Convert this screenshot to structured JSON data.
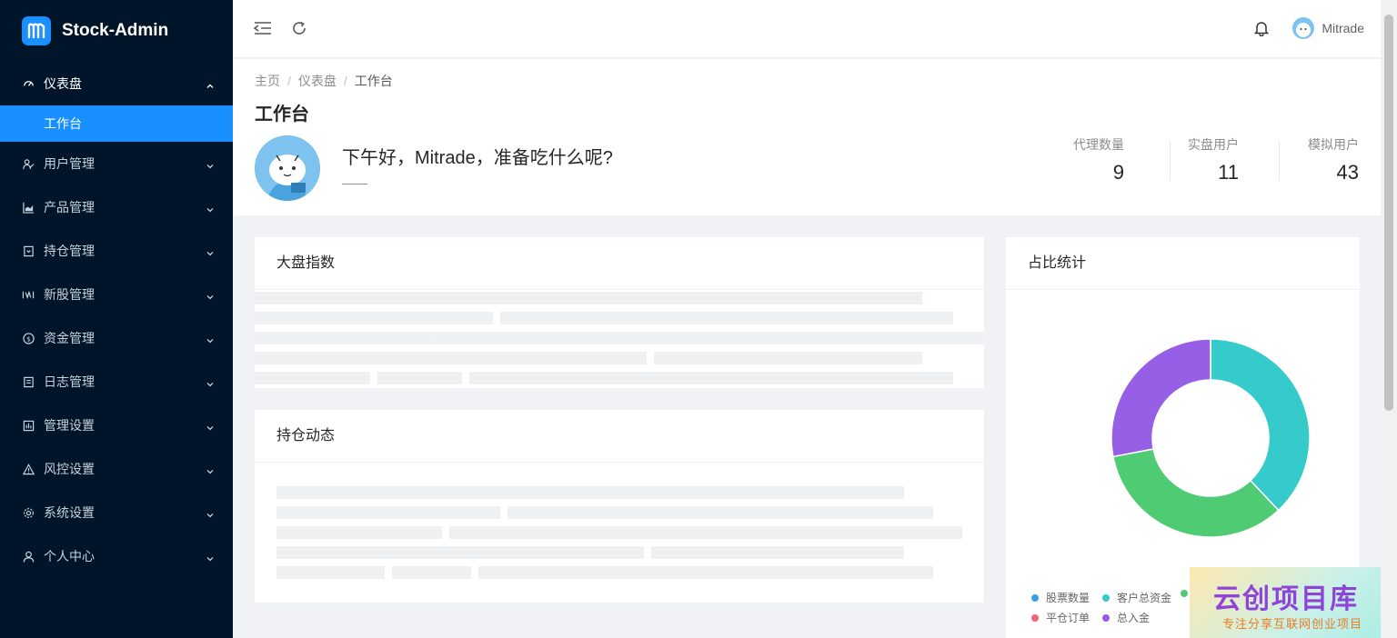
{
  "app": {
    "title": "Stock-Admin"
  },
  "sidebar": {
    "items": [
      {
        "label": "仪表盘",
        "icon": "dashboard-icon",
        "open": true,
        "children": [
          {
            "label": "工作台"
          }
        ]
      },
      {
        "label": "用户管理",
        "icon": "users-icon"
      },
      {
        "label": "产品管理",
        "icon": "chart-icon"
      },
      {
        "label": "持仓管理",
        "icon": "position-icon"
      },
      {
        "label": "新股管理",
        "icon": "ipo-icon"
      },
      {
        "label": "资金管理",
        "icon": "money-icon"
      },
      {
        "label": "日志管理",
        "icon": "log-icon"
      },
      {
        "label": "管理设置",
        "icon": "admin-settings-icon"
      },
      {
        "label": "风控设置",
        "icon": "warning-icon"
      },
      {
        "label": "系统设置",
        "icon": "gear-icon"
      },
      {
        "label": "个人中心",
        "icon": "user-icon"
      }
    ]
  },
  "header": {
    "username": "Mitrade"
  },
  "breadcrumb": {
    "home": "主页",
    "level1": "仪表盘",
    "current": "工作台"
  },
  "page": {
    "title": "工作台",
    "greeting": "下午好，Mitrade，准备吃什么呢?",
    "greeting_sub": "——"
  },
  "stats": [
    {
      "label": "代理数量",
      "value": "9"
    },
    {
      "label": "实盘用户",
      "value": "11"
    },
    {
      "label": "模拟用户",
      "value": "43"
    }
  ],
  "cards": {
    "market_index": "大盘指数",
    "positions": "持仓动态",
    "ratio": "占比统计"
  },
  "chart_data": {
    "type": "pie",
    "title": "占比统计",
    "legend_position": "bottom",
    "series": [
      {
        "name": "股票数量",
        "value": 0,
        "color": "#3aa1e8"
      },
      {
        "name": "客户总资金",
        "value": 38,
        "color": "#36cbcb"
      },
      {
        "name": "",
        "value": 34,
        "color": "#4ecb73"
      },
      {
        "name": "平仓订单",
        "value": 0,
        "color": "#f2637b"
      },
      {
        "name": "总入金",
        "value": 28,
        "color": "#975fe5"
      }
    ]
  },
  "watermark": {
    "main": "云创项目库",
    "sub": "专注分享互联网创业项目"
  }
}
